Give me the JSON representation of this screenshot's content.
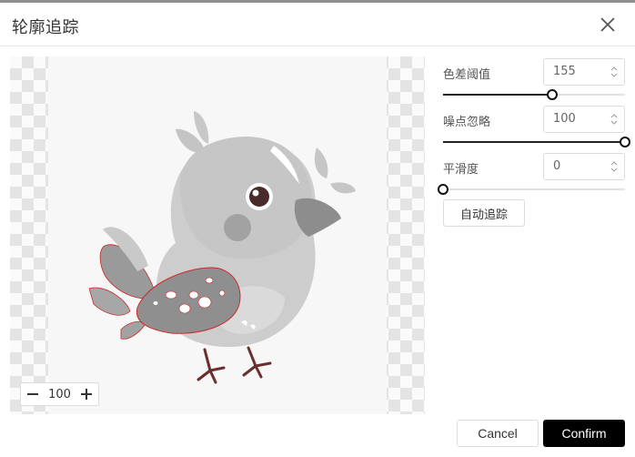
{
  "dialog": {
    "title": "轮廓追踪"
  },
  "preview": {
    "zoom": {
      "value": "100"
    }
  },
  "controls": {
    "color_threshold": {
      "label": "色差阈值",
      "value": "155",
      "fraction": 0.6
    },
    "noise_ignore": {
      "label": "噪点忽略",
      "value": "100",
      "fraction": 1.0
    },
    "smoothness": {
      "label": "平滑度",
      "value": "0",
      "fraction": 0.0
    },
    "auto_trace_label": "自动追踪"
  },
  "footer": {
    "cancel_label": "Cancel",
    "confirm_label": "Confirm"
  },
  "colors": {
    "accent": "#000000",
    "trace_outline": "#cc2a2a"
  },
  "icons": {
    "close": "close-icon",
    "zoom_out": "minus-icon",
    "zoom_in": "plus-icon",
    "spinner": "spinner-arrows-icon"
  }
}
